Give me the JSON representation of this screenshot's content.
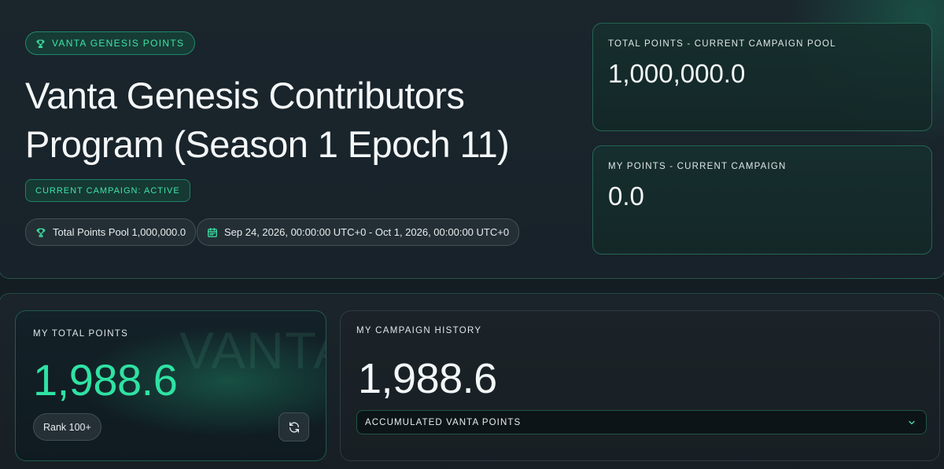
{
  "hero": {
    "badge": "VANTA GENESIS POINTS",
    "title_line1": "Vanta Genesis Contributors",
    "title_line2": "Program (Season 1 Epoch 11)",
    "status": "CURRENT CAMPAIGN: ACTIVE",
    "pool_pill": "Total Points Pool 1,000,000.0",
    "date_range": "Sep 24, 2026, 00:00:00 UTC+0 - Oct 1, 2026, 00:00:00 UTC+0"
  },
  "stats": {
    "pool_label": "TOTAL POINTS - CURRENT CAMPAIGN POOL",
    "pool_value": "1,000,000.0",
    "mine_label": "MY POINTS - CURRENT CAMPAIGN",
    "mine_value": "0.0"
  },
  "total_card": {
    "watermark": "VANTA",
    "label": "MY TOTAL POINTS",
    "value": "1,988.6",
    "rank": "Rank 100+"
  },
  "history_card": {
    "label": "MY CAMPAIGN HISTORY",
    "value": "1,988.6",
    "selected": "ACCUMULATED VANTA POINTS"
  },
  "colors": {
    "accent": "#2fe2a3",
    "background": "#141c20"
  },
  "icons": {
    "trophy": "trophy-icon",
    "calendar": "calendar-icon",
    "refresh": "refresh-icon",
    "chevron": "chevron-down-icon"
  }
}
